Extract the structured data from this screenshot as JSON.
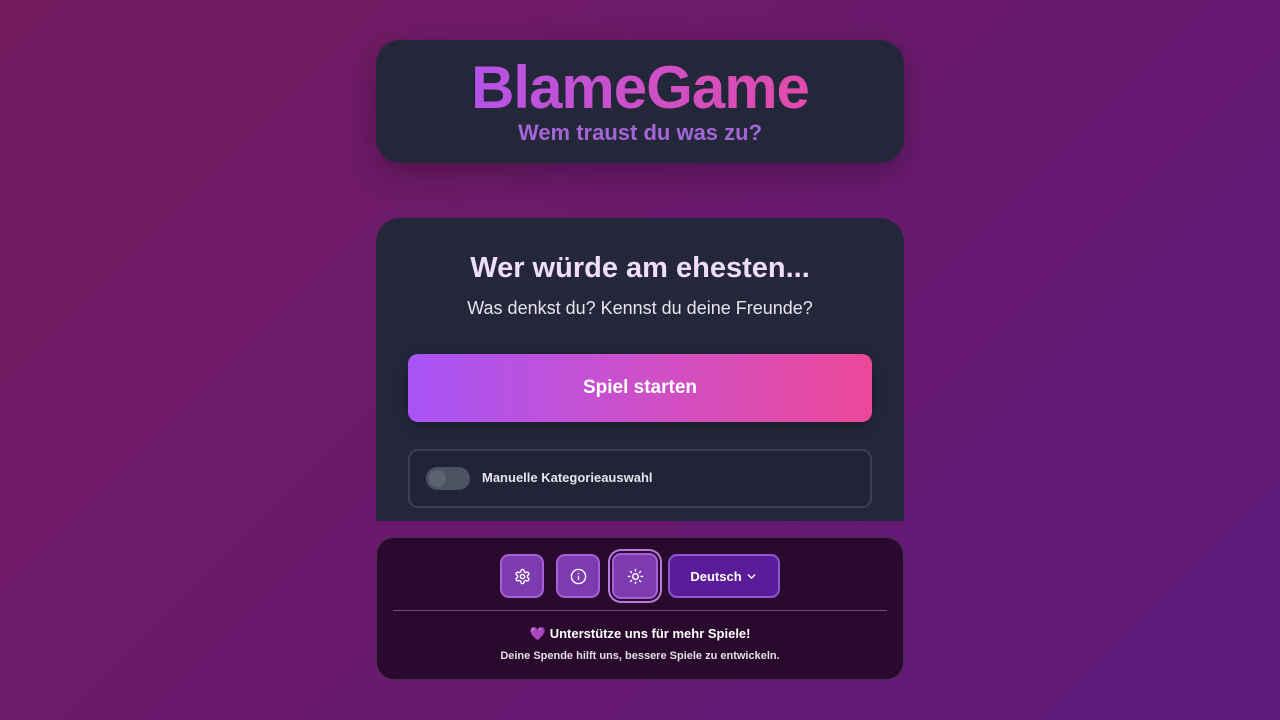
{
  "header": {
    "title": "BlameGame",
    "subtitle": "Wem traust du was zu?"
  },
  "main": {
    "title": "Wer würde am ehesten...",
    "subtitle": "Was denkst du? Kennst du deine Freunde?",
    "start_button": "Spiel starten",
    "manual_category_label": "Manuelle Kategorieauswahl",
    "manual_category_enabled": false
  },
  "footer": {
    "settings_icon": "gear-icon",
    "info_icon": "info-icon",
    "theme_icon": "sun-icon",
    "language": "Deutsch",
    "support_heart": "💜",
    "support_title": "Unterstütze uns für mehr Spiele!",
    "donation_text": "Deine Spende hilft uns, bessere Spiele zu entwickeln."
  },
  "colors": {
    "accent_start": "#a855f7",
    "accent_end": "#ec4899",
    "card_bg": "#24273a",
    "footer_bg": "#2a0a2c"
  }
}
